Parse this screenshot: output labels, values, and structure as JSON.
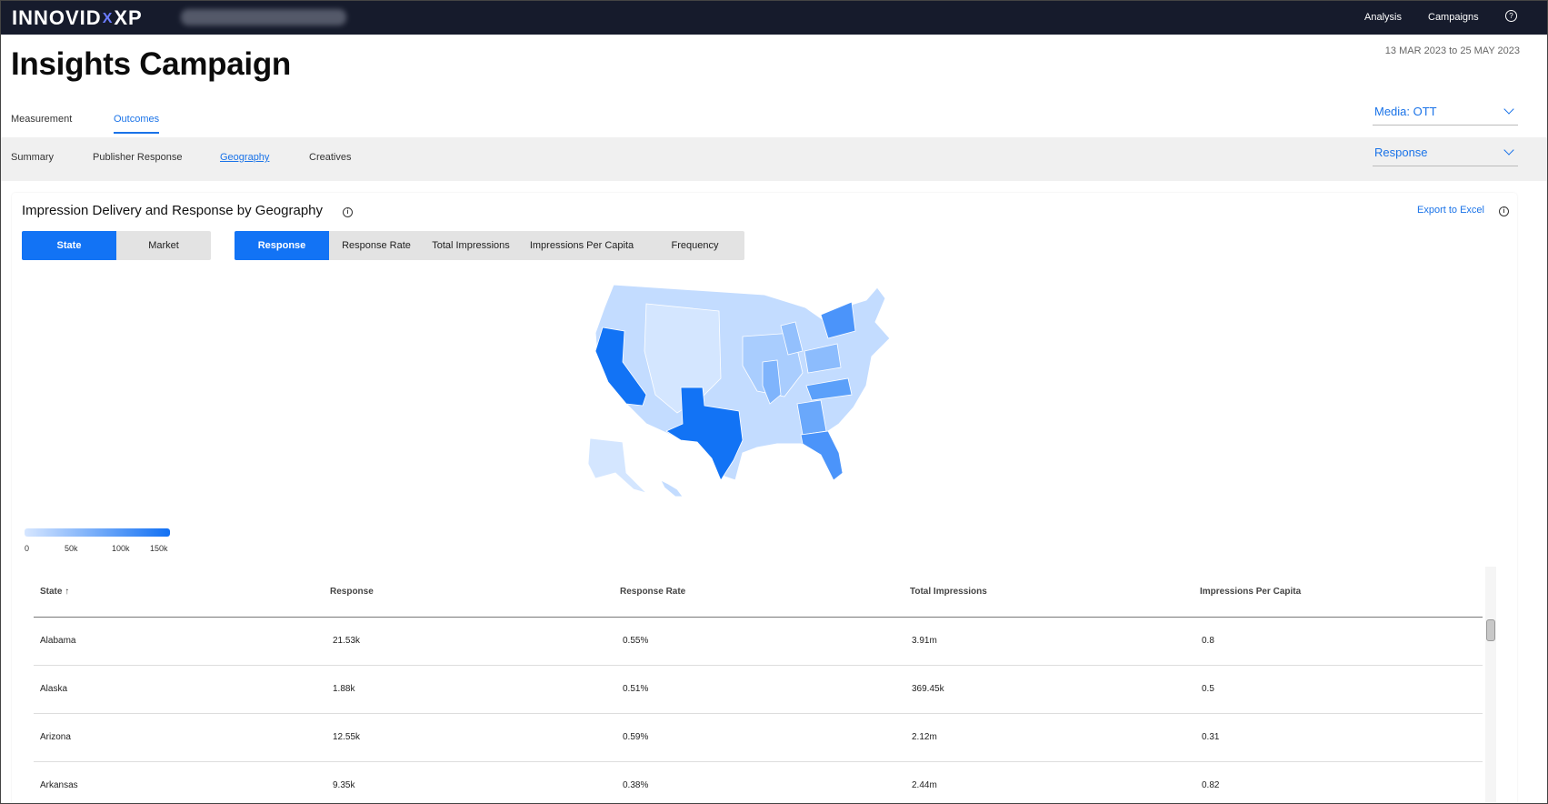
{
  "app": {
    "logo_left": "INNOVID",
    "logo_x": "X",
    "logo_right": "XP"
  },
  "topnav": {
    "analysis": "Analysis",
    "campaigns": "Campaigns",
    "help_icon": "question-circle-icon"
  },
  "page": {
    "title": "Insights Campaign",
    "date_range": "13 MAR 2023 to 25 MAY 2023"
  },
  "tabs": [
    "Measurement",
    "Outcomes"
  ],
  "subtabs": [
    "Summary",
    "Publisher Response",
    "Geography",
    "Creatives"
  ],
  "media_dropdown": {
    "label": "Media:  OTT"
  },
  "metric_dropdown": {
    "label": "Response"
  },
  "card": {
    "title": "Impression Delivery and Response by Geography",
    "export": "Export to Excel",
    "geo_toggle": [
      "State",
      "Market"
    ],
    "metric_toggle": [
      "Response",
      "Response Rate",
      "Total Impressions",
      "Impressions Per Capita",
      "Frequency"
    ]
  },
  "legend": {
    "ticks": [
      "0",
      "50k",
      "100k",
      "150k"
    ],
    "color_low": "#d6e6ff",
    "color_high": "#1170f3"
  },
  "table": {
    "headers": [
      "State ↑",
      "Response",
      "Response Rate",
      "Total Impressions",
      "Impressions Per Capita"
    ],
    "rows": [
      [
        "Alabama",
        "21.53k",
        "0.55%",
        "3.91m",
        "0.8"
      ],
      [
        "Alaska",
        "1.88k",
        "0.51%",
        "369.45k",
        "0.5"
      ],
      [
        "Arizona",
        "12.55k",
        "0.59%",
        "2.12m",
        "0.31"
      ],
      [
        "Arkansas",
        "9.35k",
        "0.38%",
        "2.44m",
        "0.82"
      ]
    ]
  },
  "colors": {
    "accent": "#1273f5",
    "topbar": "#161b2c"
  }
}
